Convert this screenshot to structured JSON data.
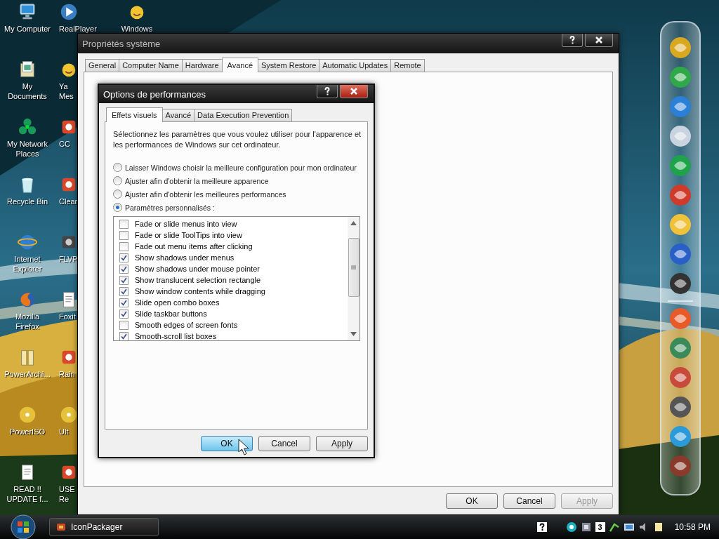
{
  "desktop_icons": [
    {
      "label": "My Computer",
      "kind": "computer"
    },
    {
      "label": "My\nDocuments",
      "kind": "documents"
    },
    {
      "label": "My Network\nPlaces",
      "kind": "network"
    },
    {
      "label": "Recycle Bin",
      "kind": "recycle"
    },
    {
      "label": "Internet\nExplorer",
      "kind": "browser"
    },
    {
      "label": "Mozilla\nFirefox",
      "kind": "firefox"
    },
    {
      "label": "PowerArchi...",
      "kind": "archive"
    },
    {
      "label": "PowerISO",
      "kind": "disc"
    },
    {
      "label": "READ !!\nUPDATE f...",
      "kind": "note"
    },
    {
      "label": "RealPlayer",
      "kind": "player"
    },
    {
      "label": "Ya\nMes",
      "kind": "messenger"
    },
    {
      "label": "CC",
      "kind": "app"
    },
    {
      "label": "Clear",
      "kind": "app"
    },
    {
      "label": "FLVP",
      "kind": "film"
    },
    {
      "label": "Foxit",
      "kind": "note"
    },
    {
      "label": "Rain",
      "kind": "app"
    },
    {
      "label": "Ult",
      "kind": "disc"
    },
    {
      "label": "USE\nRe",
      "kind": "app"
    },
    {
      "label": "Windows",
      "kind": "messenger"
    }
  ],
  "system_properties": {
    "title": "Propriétés système",
    "tabs": [
      {
        "label": "General",
        "selected": false
      },
      {
        "label": "Computer Name",
        "selected": false
      },
      {
        "label": "Hardware",
        "selected": false
      },
      {
        "label": "Avancé",
        "selected": true
      },
      {
        "label": "System Restore",
        "selected": false
      },
      {
        "label": "Automatic Updates",
        "selected": false
      },
      {
        "label": "Remote",
        "selected": false
      }
    ],
    "buttons": [
      {
        "label": "OK",
        "disabled": false
      },
      {
        "label": "Cancel",
        "disabled": false
      },
      {
        "label": "Apply",
        "disabled": true
      }
    ]
  },
  "performance_options": {
    "title": "Options de performances",
    "tabs": [
      {
        "label": "Effets visuels",
        "selected": true
      },
      {
        "label": "Avancé",
        "selected": false
      },
      {
        "label": "Data Execution Prevention",
        "selected": false
      }
    ],
    "description": "Sélectionnez les paramètres que vous voulez utiliser pour l'apparence et les performances de Windows sur cet ordinateur.",
    "radios": [
      {
        "label": "Laisser Windows choisir la meilleure configuration pour mon ordinateur",
        "selected": false
      },
      {
        "label": "Ajuster afin d'obtenir la meilleure apparence",
        "selected": false
      },
      {
        "label": "Ajuster afin d'obtenir les meilleures performances",
        "selected": false
      },
      {
        "label": "Paramètres personnalisés :",
        "selected": true
      }
    ],
    "effects": [
      {
        "label": "Fade or slide menus into view",
        "checked": false
      },
      {
        "label": "Fade or slide ToolTips into view",
        "checked": false
      },
      {
        "label": "Fade out menu items after clicking",
        "checked": false
      },
      {
        "label": "Show shadows under menus",
        "checked": true
      },
      {
        "label": "Show shadows under mouse pointer",
        "checked": true
      },
      {
        "label": "Show translucent selection rectangle",
        "checked": true
      },
      {
        "label": "Show window contents while dragging",
        "checked": true
      },
      {
        "label": "Slide open combo boxes",
        "checked": true
      },
      {
        "label": "Slide taskbar buttons",
        "checked": true
      },
      {
        "label": "Smooth edges of screen fonts",
        "checked": false
      },
      {
        "label": "Smooth-scroll list boxes",
        "checked": true
      }
    ],
    "buttons": [
      {
        "label": "OK",
        "focused": true
      },
      {
        "label": "Cancel",
        "focused": false
      },
      {
        "label": "Apply",
        "focused": false
      }
    ]
  },
  "taskbar": {
    "tasks": [
      {
        "label": "IconPackager"
      }
    ],
    "tray_badge": "3",
    "clock": "10:58 PM"
  }
}
